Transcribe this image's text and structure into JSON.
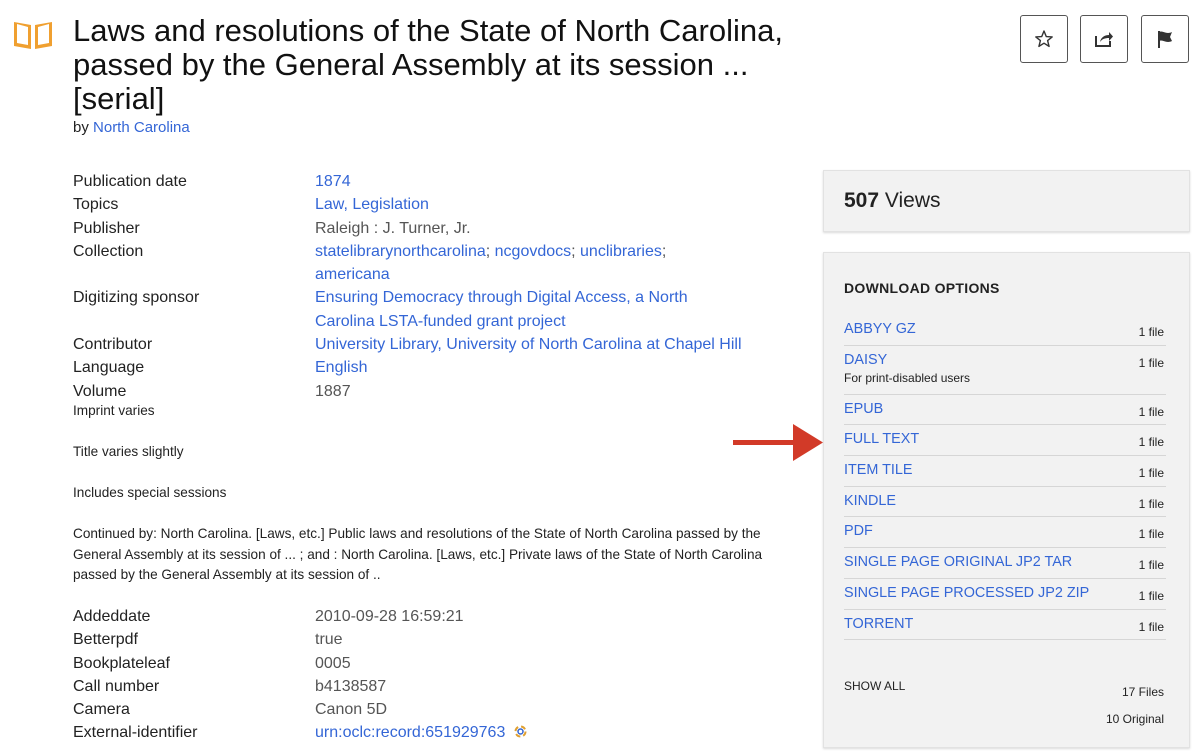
{
  "header": {
    "title": "Laws and resolutions of the State of North Carolina, passed by the General Assembly at its session ... [serial]",
    "by_prefix": "by",
    "author": "North Carolina",
    "book_icon": "open-book-icon",
    "buttons": {
      "favorite_icon": "star-icon",
      "share_icon": "share-icon",
      "flag_icon": "flag-icon"
    }
  },
  "metadata": [
    {
      "key": "Publication date",
      "value": "1874"
    },
    {
      "key": "Topics",
      "value": "Law, Legislation"
    },
    {
      "key": "Publisher",
      "value": "Raleigh : J. Turner, Jr."
    },
    {
      "key": "Collection",
      "links": [
        "statelibrarynorthcarolina",
        "ncgovdocs",
        "unclibraries",
        "americana"
      ]
    },
    {
      "key": "Digitizing sponsor",
      "value": "Ensuring Democracy through Digital Access, a North Carolina LSTA-funded grant project"
    },
    {
      "key": "Contributor",
      "value": "University Library, University of North Carolina at Chapel Hill"
    },
    {
      "key": "Language",
      "value": "English"
    },
    {
      "key": "Volume",
      "value": "1887"
    }
  ],
  "notes": [
    "Imprint varies",
    "Title varies slightly",
    "Includes special sessions",
    "Continued by: North Carolina. [Laws, etc.] Public laws and resolutions of the State of North Carolina passed by the General Assembly at its session of ... ; and : North Carolina. [Laws, etc.] Private laws of the State of North Carolina passed by the General Assembly at its session of .."
  ],
  "metadata2": [
    {
      "key": "Addeddate",
      "value": "2010-09-28 16:59:21"
    },
    {
      "key": "Betterpdf",
      "value": "true"
    },
    {
      "key": "Bookplateleaf",
      "value": "0005"
    },
    {
      "key": "Call number",
      "value": "b4138587"
    },
    {
      "key": "Camera",
      "value": "Canon 5D"
    },
    {
      "key": "External-identifier",
      "value": "urn:oclc:record:651929763"
    }
  ],
  "views": {
    "count": "507",
    "label": "Views"
  },
  "downloads": {
    "heading": "DOWNLOAD OPTIONS",
    "items": [
      {
        "format": "ABBYY GZ",
        "count": "1 file"
      },
      {
        "format": "DAISY",
        "count": "1 file",
        "note": "For print-disabled users"
      },
      {
        "format": "EPUB",
        "count": "1 file"
      },
      {
        "format": "FULL TEXT",
        "count": "1 file"
      },
      {
        "format": "ITEM TILE",
        "count": "1 file"
      },
      {
        "format": "KINDLE",
        "count": "1 file"
      },
      {
        "format": "PDF",
        "count": "1 file"
      },
      {
        "format": "SINGLE PAGE ORIGINAL JP2 TAR",
        "count": "1 file"
      },
      {
        "format": "SINGLE PAGE PROCESSED JP2 ZIP",
        "count": "1 file"
      },
      {
        "format": "TORRENT",
        "count": "1 file"
      }
    ],
    "show_all": "SHOW ALL",
    "total_files": "17 Files",
    "total_original": "10 Original"
  },
  "colors": {
    "link": "#3466d6",
    "arrow": "#d23a28",
    "book_icon": "#f0a030",
    "panel": "#f2f2f2"
  }
}
